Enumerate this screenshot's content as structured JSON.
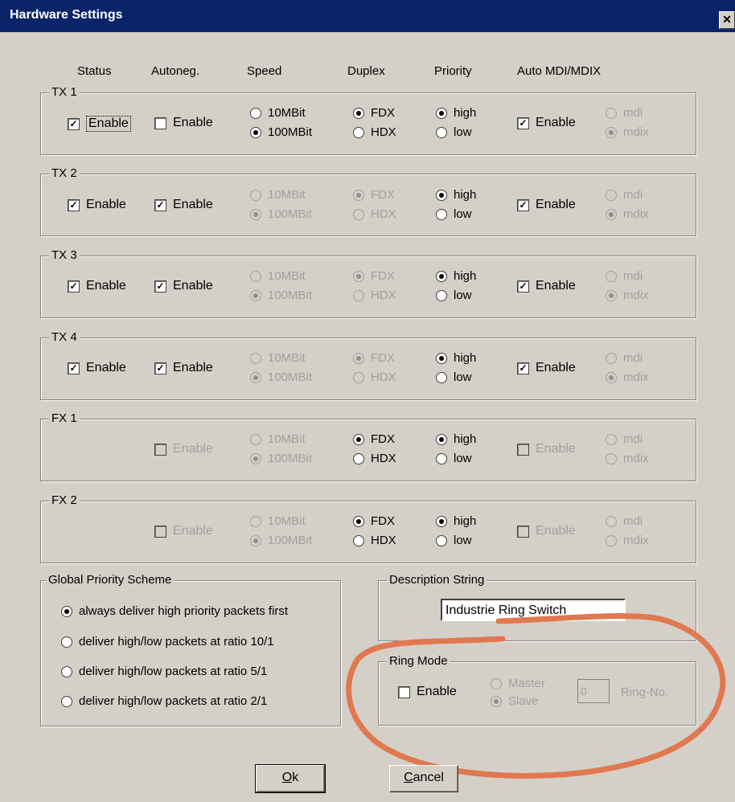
{
  "window": {
    "title": "Hardware Settings",
    "close_glyph": "✕"
  },
  "columns": [
    "Status",
    "Autoneg.",
    "Speed",
    "Duplex",
    "Priority",
    "Auto MDI/MDIX"
  ],
  "ports": [
    {
      "label": "TX 1"
    },
    {
      "label": "TX 2"
    },
    {
      "label": "TX 3"
    },
    {
      "label": "TX 4"
    },
    {
      "label": "FX 1"
    },
    {
      "label": "FX 2"
    }
  ],
  "labels": {
    "enable": "Enable",
    "speed_10": "10MBit",
    "speed_100": "100MBit",
    "fdx": "FDX",
    "hdx": "HDX",
    "high": "high",
    "low": "low",
    "mdi": "mdi",
    "mdix": "mdix"
  },
  "global_priority": {
    "title": "Global Priority Scheme",
    "options": [
      "always deliver high priority packets first",
      "deliver high/low packets at ratio 10/1",
      "deliver high/low packets at ratio 5/1",
      "deliver high/low packets at ratio 2/1"
    ]
  },
  "description": {
    "title": "Description String",
    "value": "Industrie Ring Switch"
  },
  "ring_mode": {
    "title": "Ring Mode",
    "enable": "Enable",
    "master": "Master",
    "slave": "Slave",
    "ring_no_value": "0",
    "ring_no_label": "Ring-No."
  },
  "buttons": {
    "ok_rest": "k",
    "ok_key": "O",
    "cancel_key": "C",
    "cancel_rest": "ancel"
  },
  "colors": {
    "title_bar": "#0a246a",
    "dialog": "#d4d0c8",
    "annotation": "#e07850"
  }
}
